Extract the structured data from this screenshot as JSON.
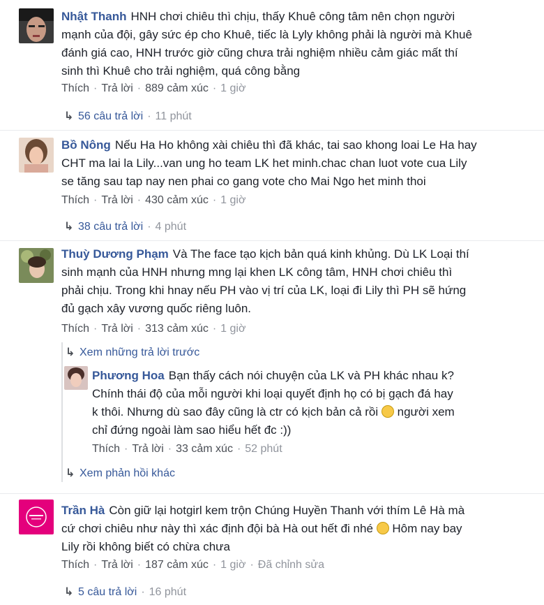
{
  "comments": [
    {
      "author": "Nhật Thanh",
      "text_lines": [
        "HNH chơi chiêu thì chịu, thấy Khuê công tâm nên chọn người",
        "mạnh của đội, gây sức ép cho Khuê, tiếc là Lyly không phải là người mà Khuê",
        "đánh giá cao, HNH trước giờ cũng chưa trải nghiệm nhiều cảm giác mất thí",
        "sinh thì Khuê cho trải nghiệm, quá công bằng"
      ],
      "like": "Thích",
      "reply": "Trả lời",
      "reactions": "889 cảm xúc",
      "time": "1 giờ",
      "replies_label": "56 câu trả lời",
      "replies_time": "11 phút"
    },
    {
      "author": "Bồ Nông",
      "text_lines": [
        "Nếu Ha Ho không xài chiêu thì đã khác, tai sao khong loai Le Ha hay",
        "CHT ma lai la Lily...van ung ho team LK het minh.chac chan luot vote cua Lily",
        "se tăng sau tap nay nen phai co gang vote cho Mai Ngo het minh thoi"
      ],
      "like": "Thích",
      "reply": "Trả lời",
      "reactions": "430 cảm xúc",
      "time": "1 giờ",
      "replies_label": "38 câu trả lời",
      "replies_time": "4 phút"
    },
    {
      "author": "Thuỳ Dương Phạm",
      "text_lines": [
        "Và The face tạo kịch bản quá kinh khủng. Dù LK Loại thí",
        "sinh mạnh của HNH nhưng mng lại khen LK công tâm, HNH chơi chiêu thì",
        "phải chịu. Trong khi hnay nếu PH vào vị trí của LK, loại đi Lily thì PH sẽ hứng",
        "đủ gạch xây vương quốc riêng luôn."
      ],
      "like": "Thích",
      "reply": "Trả lời",
      "reactions": "313 cảm xúc",
      "time": "1 giờ",
      "prev_replies_label": "Xem những trả lời trước",
      "reply_item": {
        "author": "Phương Hoa",
        "text_lines": [
          "Bạn thấy cách nói chuyện của LK và PH khác nhau k?",
          "Chính thái độ của mỗi người khi loại quyết định họ có bị gạch đá hay",
          "k thôi. Nhưng dù sao đây cũng là ctr có kịch bản cả rồi",
          "chỉ đứng ngoài làm sao hiểu hết đc :))"
        ],
        "line3_tail": "người xem",
        "like": "Thích",
        "reply": "Trả lời",
        "reactions": "33 cảm xúc",
        "time": "52 phút"
      },
      "more_replies_label": "Xem phản hồi khác"
    },
    {
      "author": "Trần Hà",
      "text_lines": [
        "Còn giữ lại hotgirl kem trộn Chúng Huyền Thanh với thím Lê Hà mà",
        "cứ chơi chiêu như này thì xác định đội bà Hà out hết đi nhé",
        "Lily rồi không biết có chừa chưa"
      ],
      "line2_tail": "Hôm nay bay",
      "like": "Thích",
      "reply": "Trả lời",
      "reactions": "187 cảm xúc",
      "time": "1 giờ",
      "edited": "Đã chỉnh sửa",
      "replies_label": "5 câu trả lời",
      "replies_time": "16 phút"
    }
  ],
  "colors": {
    "author": "#365899",
    "meta": "#90949c",
    "text": "#1d2129"
  }
}
